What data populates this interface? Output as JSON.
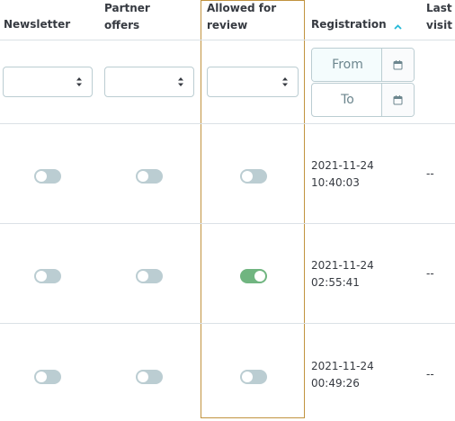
{
  "headers": {
    "newsletter": "Newsletter",
    "partner_offers": "Partner offers",
    "allowed_for_review": "Allowed for review",
    "registration": "Registration",
    "last_visit": "Last visit"
  },
  "filters": {
    "newsletter_value": "",
    "partner_offers_value": "",
    "allowed_for_review_value": "",
    "registration_from_placeholder": "From",
    "registration_to_placeholder": "To"
  },
  "rows": [
    {
      "newsletter": false,
      "partner_offers": false,
      "allowed_for_review": false,
      "registration_date": "2021-11-24",
      "registration_time": "10:40:03",
      "last_visit": "--"
    },
    {
      "newsletter": false,
      "partner_offers": false,
      "allowed_for_review": true,
      "registration_date": "2021-11-24",
      "registration_time": "02:55:41",
      "last_visit": "--"
    },
    {
      "newsletter": false,
      "partner_offers": false,
      "allowed_for_review": false,
      "registration_date": "2021-11-24",
      "registration_time": "00:49:26",
      "last_visit": "--"
    }
  ],
  "colors": {
    "accent": "#25b9d7",
    "switch_on": "#70b580",
    "switch_off": "#bbcdd2",
    "highlight_border": "#c1933f"
  },
  "icons": {
    "sort": "caret-up-icon",
    "calendar": "calendar-icon",
    "select": "select-caret-icon"
  }
}
